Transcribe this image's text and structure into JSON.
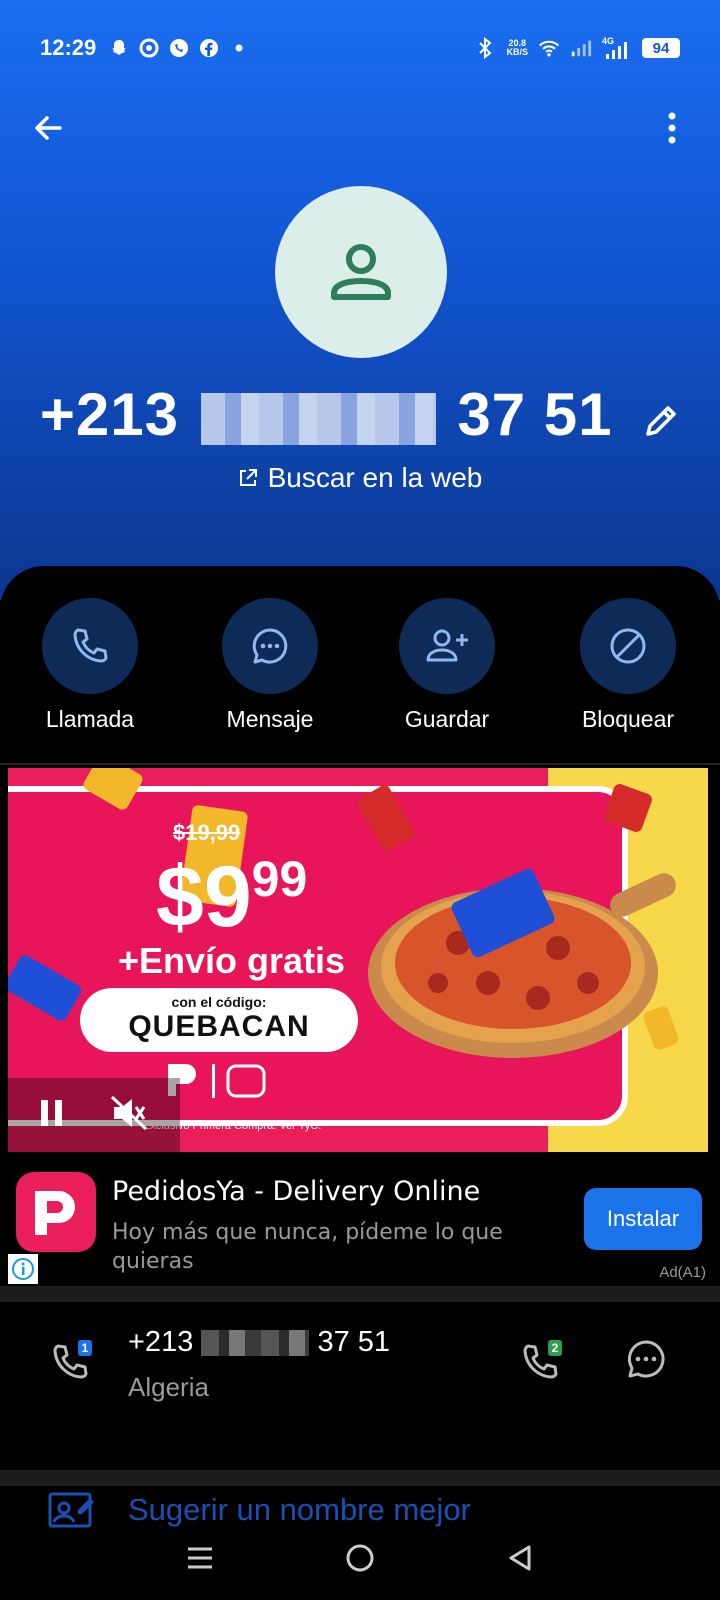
{
  "status_bar": {
    "time": "12:29",
    "net_speed_value": "20.8",
    "net_speed_unit": "KB/S",
    "network_type": "4G",
    "battery": "94"
  },
  "contact": {
    "phone_prefix": "+213",
    "phone_suffix": "37 51",
    "search_web_label": "Buscar en la web"
  },
  "actions": {
    "call": "Llamada",
    "message": "Mensaje",
    "save": "Guardar",
    "block": "Bloquear"
  },
  "ad": {
    "old_price": "$19,99",
    "price_main": "$9",
    "price_cents": "99",
    "shipping": "+Envío gratis",
    "code_label": "con el código:",
    "code": "QUEBACAN",
    "terms": "Exclusivo Primera Compra. Ver TyC.",
    "title": "PedidosYa - Delivery Online",
    "description": "Hoy más que nunca, pídeme lo que quieras",
    "install_label": "Instalar",
    "ad_label": "Ad(A1)"
  },
  "number_row": {
    "prefix": "+213",
    "suffix": "37 51",
    "country": "Algeria",
    "sim1_badge": "1",
    "sim2_badge": "2"
  },
  "suggest": {
    "label": "Sugerir un nombre mejor"
  },
  "colors": {
    "header_blue": "#1257d6",
    "action_circle": "#0e2b57",
    "ad_pink": "#ea1e5b",
    "install_blue": "#1a73e8"
  }
}
